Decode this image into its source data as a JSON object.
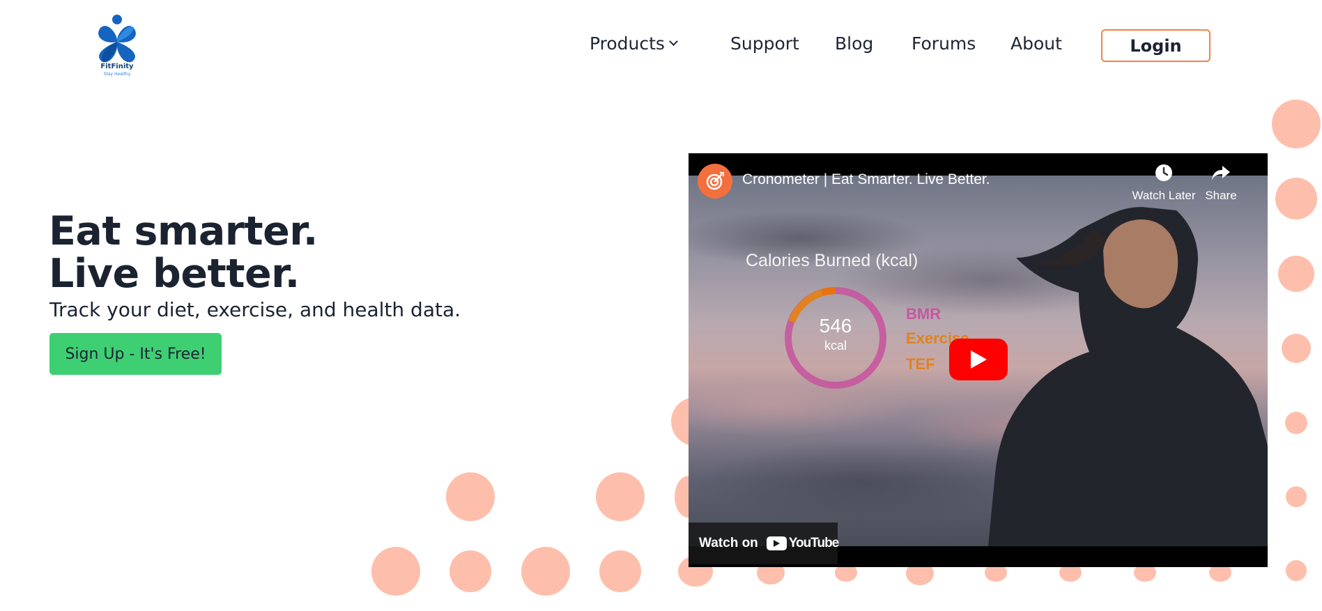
{
  "brand": {
    "name": "FitFinity",
    "tagline": "Stay Healthy",
    "colors": {
      "primary": "#1565c0",
      "accent": "#f08246",
      "cta": "#3ecf73",
      "dots": "#fdbfab"
    }
  },
  "nav": {
    "items": [
      {
        "label": "Products",
        "icon": "chevron-down-icon"
      },
      {
        "label": "Support"
      },
      {
        "label": "Blog"
      },
      {
        "label": "Forums"
      },
      {
        "label": "About"
      }
    ],
    "login_label": "Login"
  },
  "hero": {
    "title_line1": "Eat smarter.",
    "title_line2": "Live better.",
    "subtitle": "Track your diet, exercise, and health data.",
    "cta_label": "Sign Up - It's Free!"
  },
  "video": {
    "title": "Cronometer | Eat Smarter. Live Better.",
    "channel_icon": "target-icon",
    "actions": [
      {
        "label": "Watch Later",
        "icon": "clock-icon"
      },
      {
        "label": "Share",
        "icon": "share-arrow-icon"
      }
    ],
    "overlay": {
      "chart_title": "Calories Burned (kcal)",
      "value": "546",
      "unit": "kcal",
      "legend": [
        {
          "label": "BMR",
          "color": "#c6579f"
        },
        {
          "label": "Exercise",
          "color": "#e0821f"
        },
        {
          "label": "TEF",
          "color": "#e0821f"
        }
      ]
    },
    "watch_on_label": "Watch on",
    "youtube_label": "YouTube"
  }
}
